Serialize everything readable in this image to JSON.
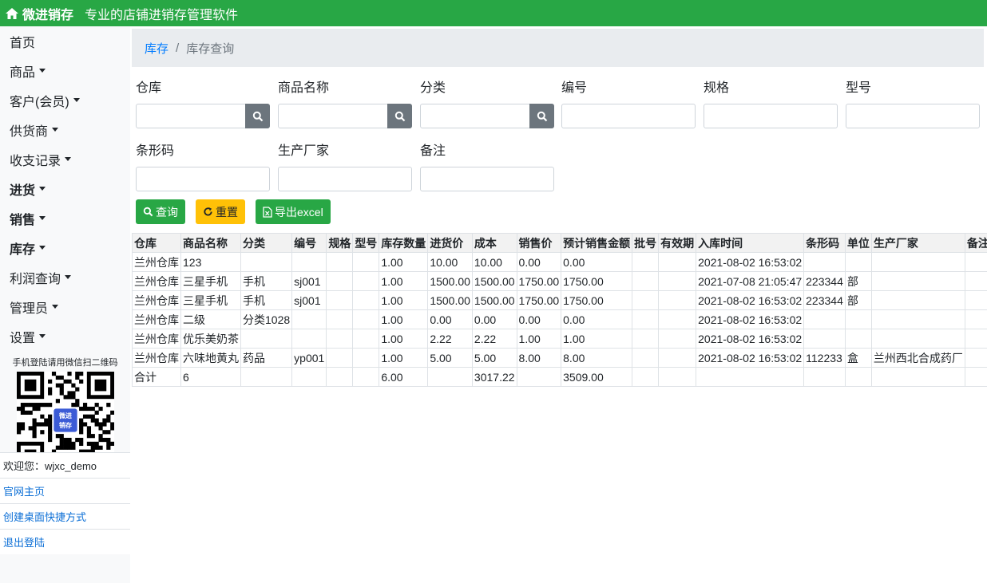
{
  "header": {
    "brand": "微进销存",
    "slogan": "专业的店铺进销存管理软件"
  },
  "sidebar": {
    "items": [
      {
        "label": "首页",
        "caret": false,
        "bold": false
      },
      {
        "label": "商品",
        "caret": true,
        "bold": false
      },
      {
        "label": "客户(会员)",
        "caret": true,
        "bold": false
      },
      {
        "label": "供货商",
        "caret": true,
        "bold": false
      },
      {
        "label": "收支记录",
        "caret": true,
        "bold": false
      },
      {
        "label": "进货",
        "caret": true,
        "bold": true
      },
      {
        "label": "销售",
        "caret": true,
        "bold": true
      },
      {
        "label": "库存",
        "caret": true,
        "bold": true
      },
      {
        "label": "利润查询",
        "caret": true,
        "bold": false
      },
      {
        "label": "管理员",
        "caret": true,
        "bold": false
      },
      {
        "label": "设置",
        "caret": true,
        "bold": false
      }
    ],
    "qr_label": "手机登陆请用微信扫二维码",
    "qr_logo_text": [
      "微进",
      "销存"
    ],
    "welcome": "欢迎您：wjxc_demo",
    "links": [
      "官网主页",
      "创建桌面快捷方式",
      "退出登陆"
    ]
  },
  "breadcrumb": {
    "parent": "库存",
    "separator": "/",
    "current": "库存查询"
  },
  "filters": {
    "warehouse": "仓库",
    "product_name": "商品名称",
    "category": "分类",
    "code": "编号",
    "spec": "规格",
    "model": "型号",
    "barcode": "条形码",
    "manufacturer": "生产厂家",
    "remark": "备注"
  },
  "buttons": {
    "query": "查询",
    "reset": "重置",
    "export": "导出excel"
  },
  "table": {
    "headers": [
      "仓库",
      "商品名称",
      "分类",
      "编号",
      "规格",
      "型号",
      "库存数量",
      "进货价",
      "成本",
      "销售价",
      "预计销售金额",
      "批号",
      "有效期",
      "入库时间",
      "条形码",
      "单位",
      "生产厂家",
      "备注"
    ],
    "rows": [
      [
        "兰州仓库",
        "123",
        "",
        "",
        "",
        "",
        "1.00",
        "10.00",
        "10.00",
        "0.00",
        "0.00",
        "",
        "",
        "2021-08-02 16:53:02",
        "",
        "",
        "",
        ""
      ],
      [
        "兰州仓库",
        "三星手机",
        "手机",
        "sj001",
        "",
        "",
        "1.00",
        "1500.00",
        "1500.00",
        "1750.00",
        "1750.00",
        "",
        "",
        "2021-07-08 21:05:47",
        "223344",
        "部",
        "",
        ""
      ],
      [
        "兰州仓库",
        "三星手机",
        "手机",
        "sj001",
        "",
        "",
        "1.00",
        "1500.00",
        "1500.00",
        "1750.00",
        "1750.00",
        "",
        "",
        "2021-08-02 16:53:02",
        "223344",
        "部",
        "",
        ""
      ],
      [
        "兰州仓库",
        "二级",
        "分类1028",
        "",
        "",
        "",
        "1.00",
        "0.00",
        "0.00",
        "0.00",
        "0.00",
        "",
        "",
        "2021-08-02 16:53:02",
        "",
        "",
        "",
        ""
      ],
      [
        "兰州仓库",
        "优乐美奶茶",
        "",
        "",
        "",
        "",
        "1.00",
        "2.22",
        "2.22",
        "1.00",
        "1.00",
        "",
        "",
        "2021-08-02 16:53:02",
        "",
        "",
        "",
        ""
      ],
      [
        "兰州仓库",
        "六味地黄丸",
        "药品",
        "yp001",
        "",
        "",
        "1.00",
        "5.00",
        "5.00",
        "8.00",
        "8.00",
        "",
        "",
        "2021-08-02 16:53:02",
        "112233",
        "盒",
        "兰州西北合成药厂",
        ""
      ],
      [
        "合计",
        "6",
        "",
        "",
        "",
        "",
        "6.00",
        "",
        "3017.22",
        "",
        "3509.00",
        "",
        "",
        "",
        "",
        "",
        "",
        ""
      ]
    ]
  },
  "colors": {
    "topbar": "#28a745",
    "search_button": "#6c757d",
    "reset_button": "#ffc107",
    "link": "#007bff"
  }
}
